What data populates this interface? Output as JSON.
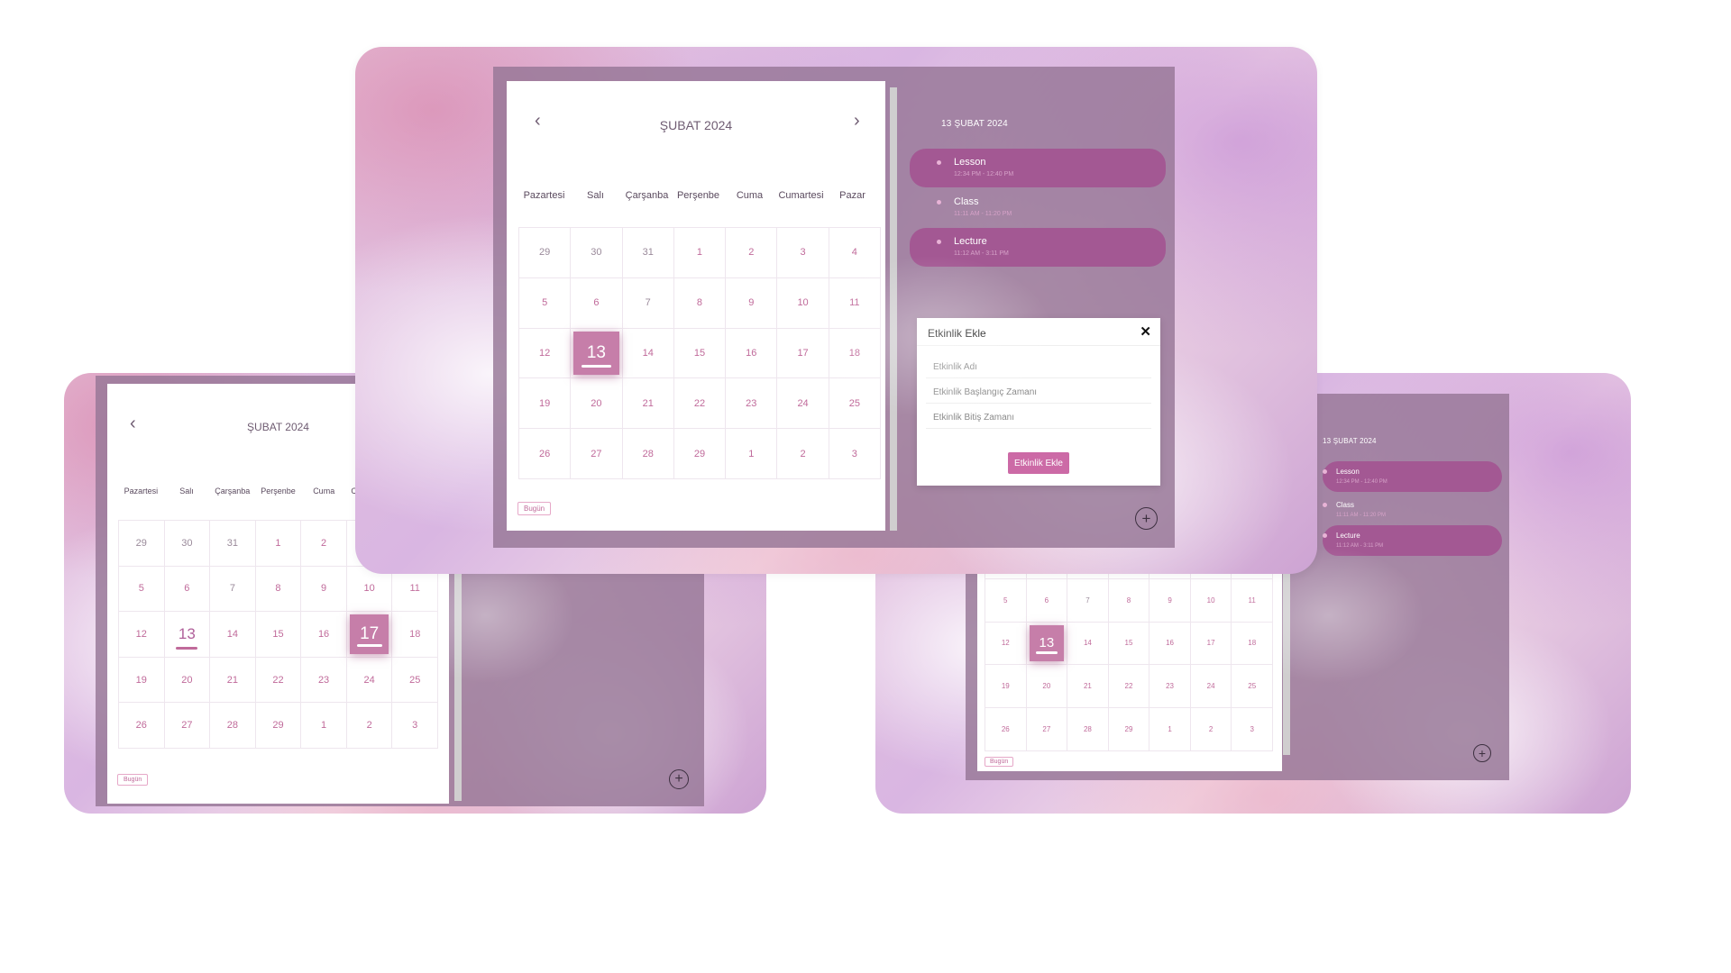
{
  "colors": {
    "accent": "#c06a9a",
    "event_fill": "#a35893",
    "selected_fill": "#c67ea9",
    "frame": "#96769a"
  },
  "calendar": {
    "month_title": "ŞUBAT 2024",
    "prev_icon": "chevron-left-icon",
    "next_icon": "chevron-right-icon",
    "weekdays": [
      "Pazartesi",
      "Salı",
      "Çarşanba",
      "Perşenbe",
      "Cuma",
      "Cumartesi",
      "Pazar"
    ],
    "days": [
      [
        "29",
        "30",
        "31",
        "1",
        "2",
        "3",
        "4"
      ],
      [
        "5",
        "6",
        "7",
        "8",
        "9",
        "10",
        "11"
      ],
      [
        "12",
        "13",
        "14",
        "15",
        "16",
        "17",
        "18"
      ],
      [
        "19",
        "20",
        "21",
        "22",
        "23",
        "24",
        "25"
      ],
      [
        "26",
        "27",
        "28",
        "29",
        "1",
        "2",
        "3"
      ]
    ],
    "today_label": "Bugün",
    "add_icon": "plus-circle-icon"
  },
  "sidebar": {
    "date": "13 ŞUBAT 2024",
    "events": [
      {
        "name": "Lesson",
        "time": "12:34 PM - 12:40 PM",
        "highlighted": true
      },
      {
        "name": "Class",
        "time": "11:11 AM - 11:20 PM",
        "highlighted": false
      },
      {
        "name": "Lecture",
        "time": "11:12 AM - 3:11 PM",
        "highlighted": true
      }
    ]
  },
  "modal": {
    "title": "Etkinlik Ekle",
    "close_icon": "close-icon",
    "name_placeholder": "Etkinlik Adı",
    "start_placeholder": "Etkinlik Başlangıç Zamanı",
    "end_placeholder": "Etkinlik Bitiş Zamanı",
    "submit_label": "Etkinlik Ekle"
  }
}
